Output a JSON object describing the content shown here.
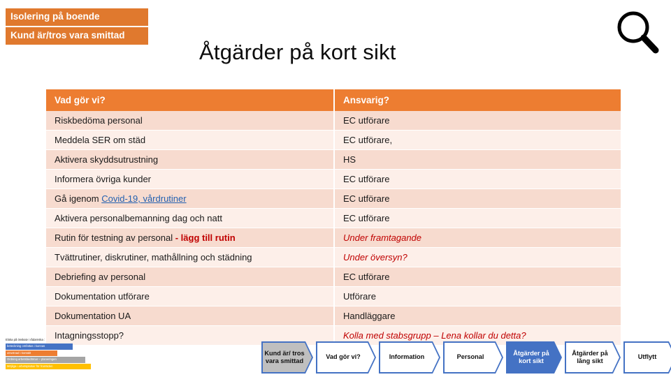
{
  "breadcrumb": {
    "chips": [
      "Isolering på boende",
      "Kund är/tros vara smittad"
    ]
  },
  "header": {
    "title": "Åtgärder på kort sikt",
    "search_icon": "search-icon"
  },
  "table": {
    "columns": [
      "Vad gör vi?",
      "Ansvarig?"
    ],
    "rows": [
      {
        "what": "Riskbedöma personal",
        "who": "EC utförare"
      },
      {
        "what": "Meddela SER om städ",
        "who": "EC utförare,"
      },
      {
        "what": "Aktivera skyddsutrustning",
        "who": "HS"
      },
      {
        "what": "Informera övriga kunder",
        "who": "EC utförare"
      },
      {
        "what": "Gå igenom Covid-19, vårdrutiner",
        "what_prefix": "Gå igenom ",
        "what_link": "Covid-19, vårdrutiner",
        "who": "EC utförare"
      },
      {
        "what": "Aktivera personalbemanning dag och natt",
        "who": "EC utförare"
      },
      {
        "what": "Rutin för testning av personal - lägg till rutin",
        "what_prefix": "Rutin för testning av personal ",
        "what_warn": "- lägg till rutin",
        "who": "Under framtagande"
      },
      {
        "what": "Tvättrutiner, diskrutiner, mathållning och städning",
        "who": "Under översyn?"
      },
      {
        "what": "Debriefing av personal",
        "who": "EC utförare"
      },
      {
        "what": "Dokumentation utförare",
        "who": "Utförare"
      },
      {
        "what": "Dokumentation UA",
        "who": "Handläggare"
      },
      {
        "what": "Intagningsstopp?",
        "who": "Kolla med stabsgrupp – Lena kollar du detta?"
      }
    ]
  },
  "legend": {
    "title": "Eloka på önskatv i rådarnska :",
    "items": [
      {
        "label": "beteckning omfattas i kunnas",
        "color": "#4472C4"
      },
      {
        "label": "utrustnad i kontakt",
        "color": "#ED7D31"
      },
      {
        "label": "Ordning arbetsbedömar – planeringen",
        "color": "#A5A5A5"
      },
      {
        "label": "Möjliga i arbetsplatser för framtiden",
        "color": "#FFC000"
      }
    ]
  },
  "nav": {
    "items": [
      {
        "label": "Kund är/ tros vara smittad",
        "state": "gray"
      },
      {
        "label": "Vad gör vi?",
        "state": "white"
      },
      {
        "label": "Information",
        "state": "white"
      },
      {
        "label": "Personal",
        "state": "white"
      },
      {
        "label": "Åtgärder på kort sikt",
        "state": "blue"
      },
      {
        "label": "Åtgärder på lång sikt",
        "state": "white"
      },
      {
        "label": "Utflytt",
        "state": "white"
      }
    ]
  },
  "colors": {
    "orange_chip": "#E0792E",
    "orange_header": "#ED7D31",
    "row_dark": "#F7DBCF",
    "row_light": "#FDEFE9",
    "link_blue": "#2461B0",
    "warn_red": "#C00000",
    "nav_blue": "#4472C4",
    "nav_gray": "#BFBFBF"
  }
}
